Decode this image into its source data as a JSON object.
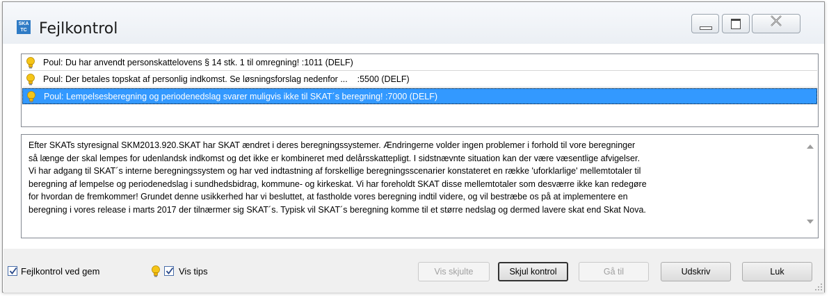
{
  "window": {
    "app_icon_text": "SKAT",
    "title": "Fejlkontrol"
  },
  "error_list": [
    {
      "text": "Poul: Du har anvendt personskattelovens § 14 stk. 1 til omregning! :1011 (DELF)",
      "selected": false
    },
    {
      "text": "Poul: Der betales topskat af personlig indkomst. Se løsningsforslag nedenfor ...    :5500 (DELF)",
      "selected": false
    },
    {
      "text": "Poul: Lempelsesberegning og periodenedslag svarer muligvis ikke til SKAT´s beregning! :7000 (DELF)",
      "selected": true
    }
  ],
  "description_lines": [
    "Efter SKATs styresignal SKM2013.920.SKAT har SKAT ændret i deres beregningssystemer. Ændringerne volder ingen problemer i forhold til vore beregninger",
    "så længe der skal lempes for udenlandsk indkomst og det ikke er kombineret med delårsskattepligt. I sidstnævnte situation kan der være væsentlige afvigelser.",
    "Vi har adgang til SKAT´s interne beregningssystem og har ved indtastning af forskellige beregningsscenarier konstateret en række 'uforklarlige' mellemtotaler til",
    "beregning af lempelse og periodenedslag i sundhedsbidrag, kommune- og kirkeskat. Vi har foreholdt SKAT disse mellemtotaler som desværre ikke kan redegøre",
    "for hvordan de fremkommer! Grundet denne usikkerhed har vi besluttet, at fastholde vores beregning indtil videre, og vil bestræbe os på at implementere en",
    "beregning i vores release i marts 2017 der tilnærmer sig SKAT´s. Typisk vil SKAT´s beregning komme til et større nedslag og dermed lavere skat end Skat Nova."
  ],
  "footer": {
    "check_on_save_label": "Fejlkontrol ved gem",
    "check_on_save_checked": true,
    "show_tips_label": "Vis tips",
    "show_tips_checked": true,
    "buttons": {
      "show_hidden": "Vis skjulte",
      "hide_check": "Skjul kontrol",
      "goto": "Gå til",
      "print": "Udskriv",
      "close": "Luk"
    }
  },
  "colors": {
    "selection": "#3399ff",
    "bulb": "#f5c518"
  }
}
